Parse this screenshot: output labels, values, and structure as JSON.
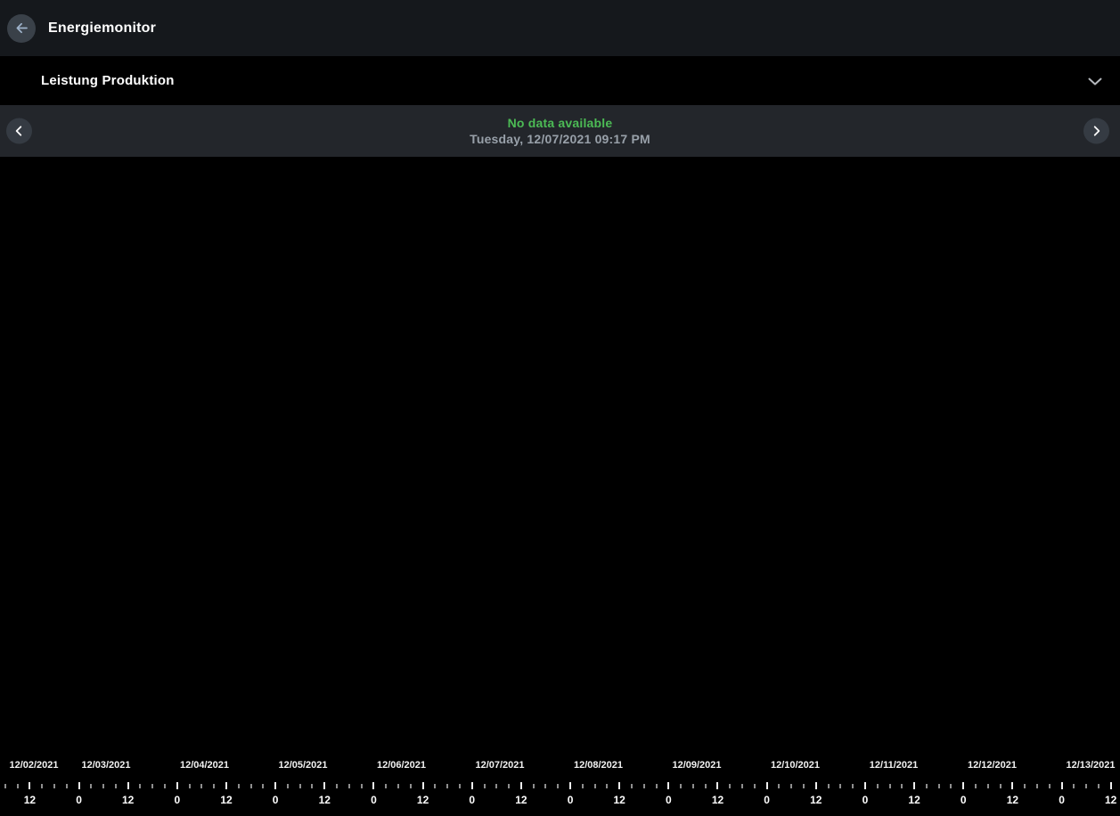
{
  "header": {
    "title": "Energiemonitor"
  },
  "panel": {
    "title": "Leistung Produktion"
  },
  "nav": {
    "status_message": "No data available",
    "timestamp": "Tuesday, 12/07/2021 09:17 PM"
  },
  "icons": {
    "back": "arrow-left-icon",
    "collapse": "chevron-down-icon",
    "prev": "chevron-left-icon",
    "next": "chevron-right-icon"
  },
  "colors": {
    "header_bg": "#15181c",
    "nav_bg": "#23262b",
    "status_green": "#4cbb55",
    "timestamp_gray": "#98a0a9",
    "back_arrow": "#9fb3cb"
  },
  "chart_data": {
    "type": "line",
    "title": "Leistung Produktion",
    "series": [],
    "annotations": [
      "No data available"
    ],
    "x_axis": {
      "dates": [
        "12/02/2021",
        "12/03/2021",
        "12/04/2021",
        "12/05/2021",
        "12/06/2021",
        "12/07/2021",
        "12/08/2021",
        "12/09/2021",
        "12/10/2021",
        "12/11/2021",
        "12/12/2021",
        "12/13/2021"
      ],
      "hour_ticks": [
        "12",
        "0",
        "12",
        "0",
        "12",
        "0",
        "12",
        "0",
        "12",
        "0",
        "12",
        "0",
        "12",
        "0",
        "12",
        "0",
        "12",
        "0",
        "12",
        "0",
        "12",
        "0",
        "12"
      ],
      "minor_tick_interval_hours": 3,
      "grid": false
    },
    "y_axis": {
      "visible": false
    }
  }
}
